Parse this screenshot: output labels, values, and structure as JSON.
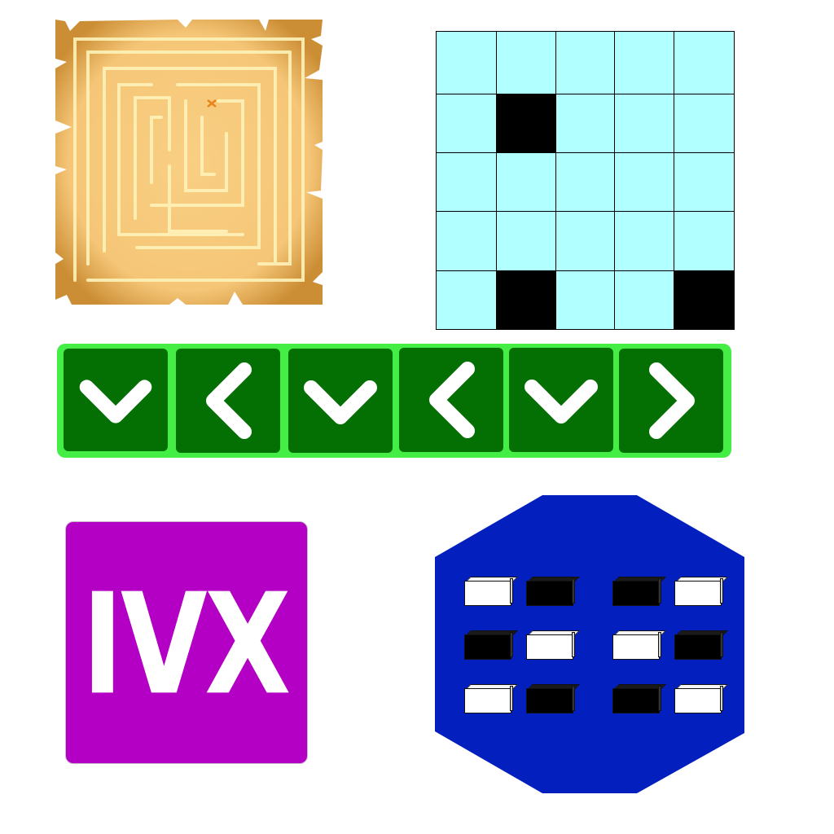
{
  "maze": {
    "marker_color": "#e8841a",
    "paper_color": "#f7c97a",
    "edge_color": "#c68a30",
    "path_color": "#fff4c4"
  },
  "grid": {
    "rows": 5,
    "cols": 5,
    "cell_color": "#b2ffff",
    "filled_color": "#000000",
    "cells": [
      [
        0,
        0,
        0,
        0,
        0
      ],
      [
        0,
        1,
        0,
        0,
        0
      ],
      [
        0,
        0,
        0,
        0,
        0
      ],
      [
        0,
        0,
        0,
        0,
        0
      ],
      [
        0,
        1,
        0,
        0,
        1
      ]
    ]
  },
  "arrows": {
    "panel_color": "#44ee44",
    "key_color": "#047004",
    "keys": [
      "down-icon",
      "left-icon",
      "down-icon",
      "left-icon",
      "down-icon",
      "right-icon"
    ]
  },
  "roman": {
    "text": "IVX",
    "tile_color": "#b400c4"
  },
  "octagon": {
    "color": "#0320bf",
    "groups": [
      [
        [
          "on",
          "off"
        ],
        [
          "off",
          "on"
        ],
        [
          "on",
          "off"
        ]
      ],
      [
        [
          "off",
          "on"
        ],
        [
          "on",
          "off"
        ],
        [
          "off",
          "on"
        ]
      ]
    ]
  }
}
